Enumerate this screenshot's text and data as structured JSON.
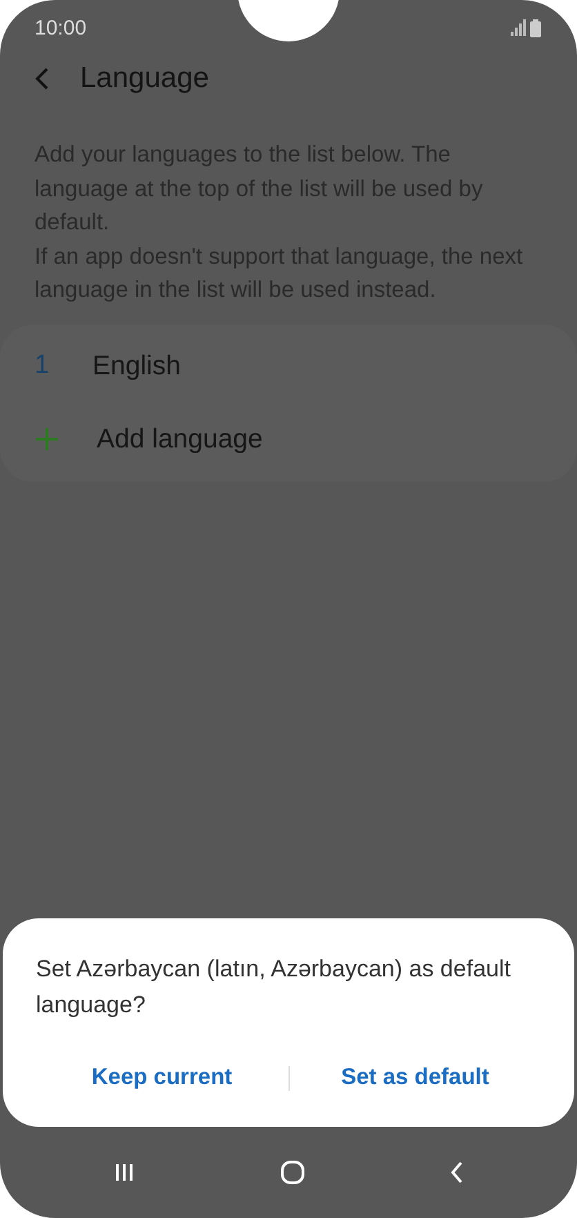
{
  "status_bar": {
    "time": "10:00"
  },
  "header": {
    "title": "Language"
  },
  "description": [
    "Add your languages to the list below. The language at the top of the list will be used by default.",
    "If an app doesn't support that language, the next language in the list will be used instead."
  ],
  "languages": [
    {
      "number": "1",
      "name": "English"
    }
  ],
  "add_item": {
    "label": "Add language"
  },
  "dialog": {
    "message": "Set Azərbaycan (latın, Azərbaycan) as default language?",
    "buttons": [
      "Keep current",
      "Set as default"
    ]
  }
}
